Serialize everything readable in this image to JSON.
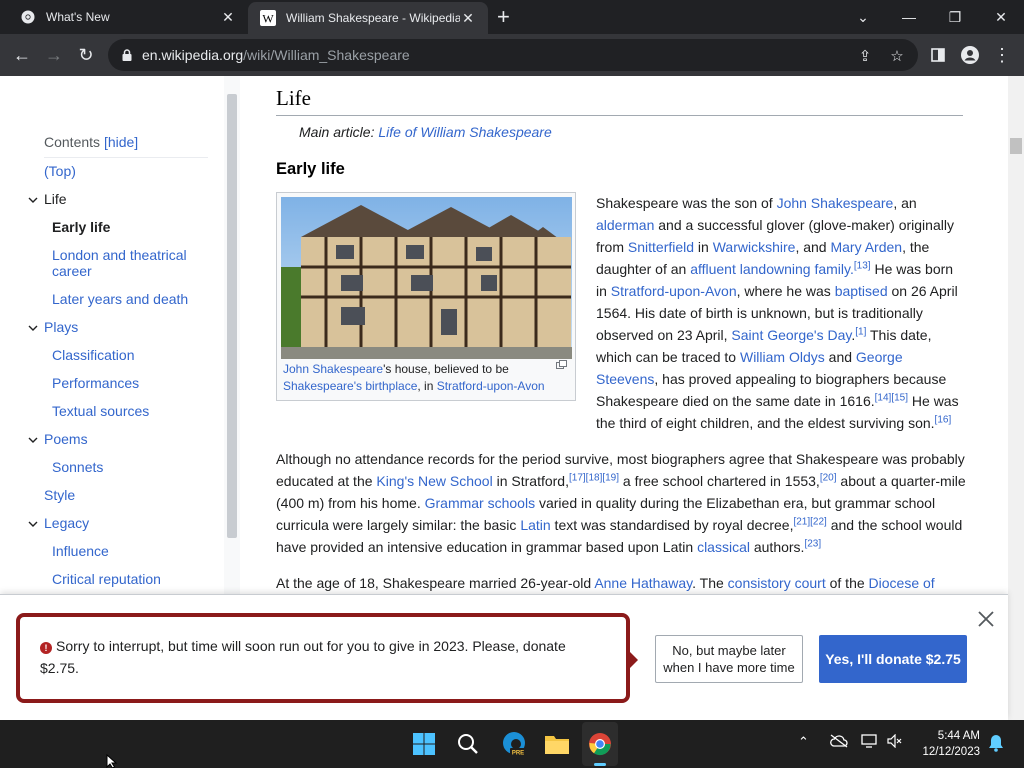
{
  "browser": {
    "tabs": [
      {
        "title": "What's New"
      },
      {
        "title": "William Shakespeare - Wikipedia"
      }
    ],
    "url_host": "en.wikipedia.org",
    "url_path": "/wiki/William_Shakespeare"
  },
  "toc": {
    "heading": "Contents",
    "hide_label": "[hide]",
    "items": [
      {
        "label": "(Top)"
      },
      {
        "label": "Life"
      },
      {
        "label": "Early life"
      },
      {
        "label": "London and theatrical career"
      },
      {
        "label": "Later years and death"
      },
      {
        "label": "Plays"
      },
      {
        "label": "Classification"
      },
      {
        "label": "Performances"
      },
      {
        "label": "Textual sources"
      },
      {
        "label": "Poems"
      },
      {
        "label": "Sonnets"
      },
      {
        "label": "Style"
      },
      {
        "label": "Legacy"
      },
      {
        "label": "Influence"
      },
      {
        "label": "Critical reputation"
      }
    ]
  },
  "article": {
    "section_title": "Life",
    "main_article_prefix": "Main article: ",
    "main_article_link": "Life of William Shakespeare",
    "subsection_title": "Early life",
    "caption": {
      "link1": "John Shakespeare",
      "text1": "'s house, believed to be",
      "link2": "Shakespeare's birthplace",
      "text2": ", in ",
      "link3": "Stratford-upon-Avon"
    },
    "p1": {
      "t1": "Shakespeare was the son of ",
      "l1": "John Shakespeare",
      "t2": ", an ",
      "l2": "alderman",
      "t3": " and a successful glover (glove-maker) originally from ",
      "l3": "Snitterfield",
      "t4": " in ",
      "l4": "Warwickshire",
      "t5": ", and ",
      "l5": "Mary Arden",
      "t6": ", the daughter of an ",
      "l6": "affluent landowning family.",
      "s1": "[13]",
      "t7": " He was born in ",
      "l7": "Stratford-upon-Avon",
      "t8": ", where he was ",
      "l8": "baptised",
      "t9": " on 26 April 1564. His date of birth is unknown, but is traditionally observed on 23 April, ",
      "l9": "Saint George's Day",
      "t9b": ".",
      "s2": "[1]",
      "t10": " This date, which can be traced to ",
      "l10": "William Oldys",
      "t11": " and ",
      "l11": "George Steevens",
      "t12": ", has proved appealing to biographers because Shakespeare died on the same date in 1616.",
      "s3": "[14][15]",
      "t13": " He was the third of eight children, and the eldest surviving son.",
      "s4": "[16]"
    },
    "p2": {
      "t1": "Although no attendance records for the period survive, most biographers agree that Shakespeare was probably educated at the ",
      "l1": "King's New School",
      "t2": " in Stratford,",
      "s1": "[17][18][19]",
      "t3": " a free school chartered in 1553,",
      "s2": "[20]",
      "t4": " about a quarter-mile (400 m) from his home. ",
      "l2": "Grammar schools",
      "t5": " varied in quality during the Elizabethan era, but grammar school curricula were largely similar: the basic ",
      "l3": "Latin",
      "t6": " text was standardised by royal decree,",
      "s3": "[21][22]",
      "t7": " and the school would have provided an intensive education in grammar based upon Latin ",
      "l4": "classical",
      "t8": " authors.",
      "s4": "[23]"
    },
    "p3": {
      "t1": "At the age of 18, Shakespeare married 26-year-old ",
      "l1": "Anne Hathaway",
      "t2": ". The ",
      "l2": "consistory court",
      "t3": " of the ",
      "l3": "Diocese of"
    }
  },
  "banner": {
    "message": "Sorry to interrupt, but time will soon run out for you to give in 2023. Please, donate $2.75.",
    "later_button_line1": "No, but maybe later",
    "later_button_line2": "when I have more time",
    "donate_button": "Yes, I'll donate $2.75"
  },
  "taskbar": {
    "time": "5:44 AM",
    "date": "12/12/2023",
    "edge_badge": "PRE"
  },
  "colors": {
    "link": "#3366cc",
    "banner_border": "#8b1a1a",
    "donate_bg": "#3366cc"
  }
}
